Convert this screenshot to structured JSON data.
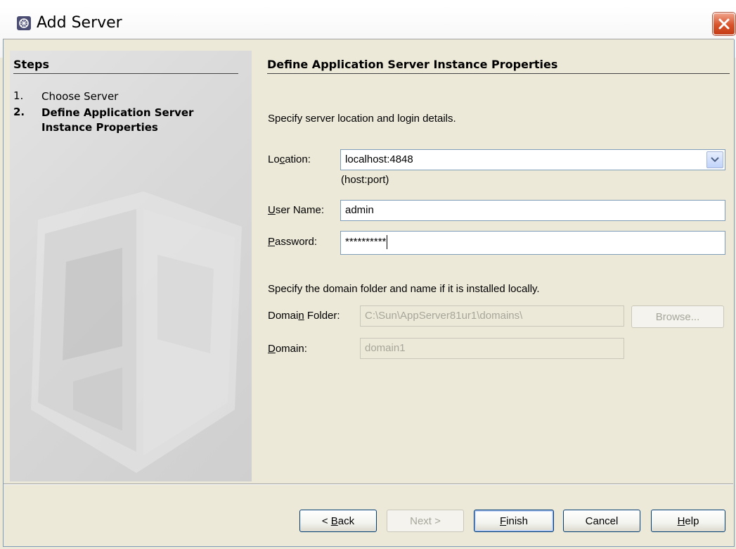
{
  "window": {
    "title": "Add Server"
  },
  "steps": {
    "heading": "Steps",
    "items": [
      {
        "number": "1.",
        "label": "Choose Server",
        "current": false
      },
      {
        "number": "2.",
        "label": "Define Application Server Instance Properties",
        "current": true
      }
    ]
  },
  "main": {
    "heading": "Define Application Server Instance Properties",
    "intro": "Specify server location and login details.",
    "location": {
      "label": "Location:",
      "value": "localhost:4848",
      "hint": "(host:port)"
    },
    "username": {
      "label": "User Name:",
      "value": "admin"
    },
    "password": {
      "label": "Password:",
      "value": "**********"
    },
    "domain_intro": "Specify the domain folder and name if it is installed locally.",
    "domain_folder": {
      "label": "Domain Folder:",
      "value": "C:\\Sun\\AppServer81ur1\\domains\\",
      "browse": "Browse..."
    },
    "domain": {
      "label": "Domain:",
      "value": "domain1"
    }
  },
  "buttons": {
    "back": "< Back",
    "next": "Next >",
    "finish": "Finish",
    "cancel": "Cancel",
    "help": "Help"
  }
}
